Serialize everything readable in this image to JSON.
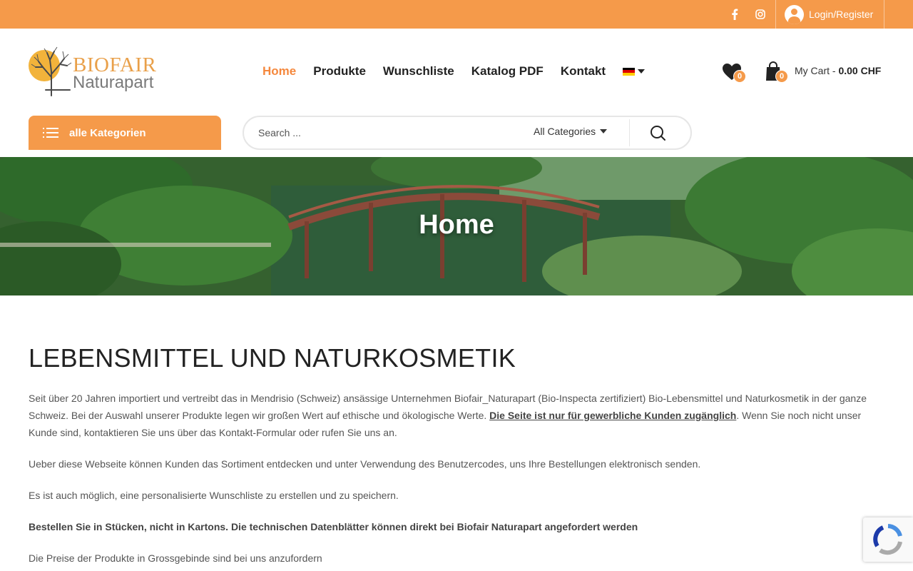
{
  "topbar": {
    "facebook_icon": "facebook-icon",
    "instagram_icon": "instagram-icon",
    "login_label": "Login/Register",
    "bg_color": "#f59a4a"
  },
  "header": {
    "logo": {
      "brand": "BIOFAIR",
      "sub": "Naturapart"
    },
    "nav": [
      {
        "label": "Home",
        "active": true
      },
      {
        "label": "Produkte"
      },
      {
        "label": "Wunschliste"
      },
      {
        "label": "Katalog PDF"
      },
      {
        "label": "Kontakt"
      }
    ],
    "language": "de-flag-icon",
    "wishlist_count": "0",
    "cart_count": "0",
    "cart_label": "My Cart - ",
    "cart_total": "0.00 CHF"
  },
  "categories_button": {
    "label": "alle Kategorien"
  },
  "search": {
    "placeholder": "Search ...",
    "category": "All Categories"
  },
  "banner": {
    "title": "Home"
  },
  "content": {
    "heading": "LEBENSMITTEL UND NATURKOSMETIK",
    "p1_text": "Seit über 20 Jahren importiert und vertreibt das in Mendrisio (Schweiz) ansässige Unternehmen Biofair_Naturapart (Bio-Inspecta zertifiziert) Bio-Lebensmittel und Naturkosmetik in der ganze Schweiz. Bei der Auswahl unserer Produkte legen wir großen Wert auf ethische und ökologische Werte. ",
    "p1_link": "Die Seite ist nur für gewerbliche Kunden zugänglich",
    "p1_after": ". Wenn Sie noch nicht unser Kunde sind, kontaktieren Sie uns über das Kontakt-Formular oder rufen Sie uns an.",
    "p2": "Ueber diese Webseite können Kunden das Sortiment entdecken und unter Verwendung des Benutzercodes, uns Ihre Bestellungen elektronisch senden.",
    "p3": "Es ist auch möglich, eine personalisierte Wunschliste zu erstellen und zu speichern.",
    "p4": "Bestellen Sie in Stücken, nicht in Kartons. Die technischen Datenblätter können direkt bei Biofair Naturapart angefordert werden",
    "p5": "Die Preise der Produkte in Grossgebinde sind bei uns anzufordern"
  },
  "colors": {
    "accent": "#f59a4a",
    "active_nav": "#f5883d"
  }
}
